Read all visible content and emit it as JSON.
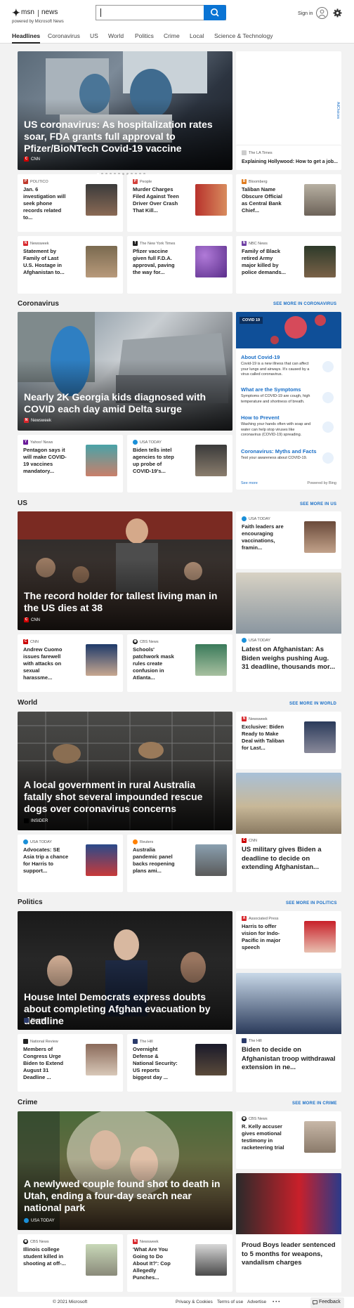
{
  "header": {
    "logo_a": "msn",
    "logo_b": "news",
    "logo_sub": "powered by Microsoft News",
    "search_placeholder": "",
    "signin": "Sign in"
  },
  "nav": [
    "Headlines",
    "Coronavirus",
    "US",
    "World",
    "Politics",
    "Crime",
    "Local",
    "Science & Technology"
  ],
  "ad": {
    "label": "AdChoices"
  },
  "top": {
    "hero": {
      "title": "US coronavirus: As hospitalization rates soar, FDA grants full approval to Pfizer/BioNTech Covid-19 vaccine",
      "source": "CNN"
    },
    "side": {
      "source": "The LA Times",
      "title": "Explaining Hollywood: How to get a job..."
    },
    "cards": [
      {
        "source": "POLITICO",
        "title": "Jan. 6 investigation will seek phone records related to..."
      },
      {
        "source": "People",
        "title": "Murder Charges Filed Against Teen Driver Over Crash That Kill..."
      },
      {
        "source": "Bloomberg",
        "title": "Taliban Name Obscure Official as Central Bank Chief..."
      },
      {
        "source": "Newsweek",
        "title": "Statement by Family of Last U.S. Hostage in Afghanistan to..."
      },
      {
        "source": "The New York Times",
        "title": "Pfizer vaccine given full F.D.A. approval, paving the way for..."
      },
      {
        "source": "NBC News",
        "title": "Family of Black retired Army major killed by police demands..."
      }
    ]
  },
  "coronavirus": {
    "heading": "Coronavirus",
    "see_more": "SEE MORE IN CORONAVIRUS",
    "hero": {
      "title": "Nearly 2K Georgia kids diagnosed with COVID each day amid Delta surge",
      "source": "Newsweek"
    },
    "cards": [
      {
        "source": "Yahoo! News",
        "title": "Pentagon says it will make COVID-19 vaccines mandatory..."
      },
      {
        "source": "USA TODAY",
        "title": "Biden tells intel agencies to step up probe of COVID-19's..."
      }
    ],
    "panel": {
      "tag": "COVID 19",
      "items": [
        {
          "title": "About Covid-19",
          "body": "Covid-19 is a new illness that can affect your lungs and airways. It's caused by a virus called coronavirus."
        },
        {
          "title": "What are the Symptoms",
          "body": "Symptoms of COVID-19 are cough, high temperature and shortness of breath."
        },
        {
          "title": "How to Prevent",
          "body": "Washing your hands often with soap and water can help stop viruses like coronavirus (COVID-19) spreading."
        },
        {
          "title": "Coronavirus: Myths and Facts",
          "body": "Test your awareness about COVID-19."
        }
      ],
      "see_more": "See more",
      "powered": "Powered by Bing"
    }
  },
  "us": {
    "heading": "US",
    "see_more": "SEE MORE IN US",
    "hero": {
      "title": "The record holder for tallest living man in the US dies at 38",
      "source": "CNN"
    },
    "side_small": {
      "source": "USA TODAY",
      "title": "Faith leaders are encouraging vaccinations, framin..."
    },
    "side_photo": {
      "source": "USA TODAY",
      "title": "Latest on Afghanistan: As Biden weighs pushing Aug. 31 deadline, thousands mor..."
    },
    "cards": [
      {
        "source": "CNN",
        "title": "Andrew Cuomo issues farewell with attacks on sexual harassme..."
      },
      {
        "source": "CBS News",
        "title": "Schools' patchwork mask rules create confusion in Atlanta..."
      }
    ]
  },
  "world": {
    "heading": "World",
    "see_more": "SEE MORE IN WORLD",
    "hero": {
      "title": "A local government in rural Australia fatally shot several impounded rescue dogs over coronavirus concerns",
      "source": "INSIDER"
    },
    "side_small": {
      "source": "Newsweek",
      "title": "Exclusive: Biden Ready to Make Deal with Taliban for Last..."
    },
    "side_photo": {
      "source": "CNN",
      "title": "US military gives Biden a deadline to decide on extending Afghanistan..."
    },
    "cards": [
      {
        "source": "USA TODAY",
        "title": "Advocates: SE Asia trip a chance for Harris to support..."
      },
      {
        "source": "Reuters",
        "title": "Australia pandemic panel backs reopening plans ami..."
      }
    ]
  },
  "politics": {
    "heading": "Politics",
    "see_more": "SEE MORE IN POLITICS",
    "hero": {
      "title": "House Intel Democrats express doubts about completing Afghan evacuation by deadline",
      "source": "The Hill"
    },
    "side_small": {
      "source": "Associated Press",
      "title": "Harris to offer vision for Indo-Pacific in major speech"
    },
    "side_photo": {
      "source": "The Hill",
      "title": "Biden to decide on Afghanistan troop withdrawal extension in ne..."
    },
    "cards": [
      {
        "source": "National Review",
        "title": "Members of Congress Urge Biden to Extend August 31 Deadline ..."
      },
      {
        "source": "The Hill",
        "title": "Overnight Defense & National Security: US reports biggest day ..."
      }
    ]
  },
  "crime": {
    "heading": "Crime",
    "see_more": "SEE MORE IN CRIME",
    "hero": {
      "title": "A newlywed couple found shot to death in Utah, ending a four-day search near national park",
      "source": "USA TODAY"
    },
    "side_small": {
      "source": "CBS News",
      "title": "R. Kelly accuser gives emotional testimony in racketeering trial"
    },
    "side_photo": {
      "source": "",
      "title": "Proud Boys leader sentenced to 5 months for weapons, vandalism charges"
    },
    "cards": [
      {
        "source": "CBS News",
        "title": "Illinois college student killed in shooting at off-..."
      },
      {
        "source": "Newsweek",
        "title": "'What Are You Going to Do About It?': Cop Allegedly Punches..."
      }
    ]
  },
  "footer": {
    "copyright": "© 2021 Microsoft",
    "privacy": "Privacy & Cookies",
    "terms": "Terms of use",
    "advertise": "Advertise",
    "more": "• • •",
    "feedback": "Feedback"
  },
  "colors": {
    "accent": "#1a6fc7",
    "search_button": "#0a74d4",
    "background": "#f2f2f2"
  }
}
